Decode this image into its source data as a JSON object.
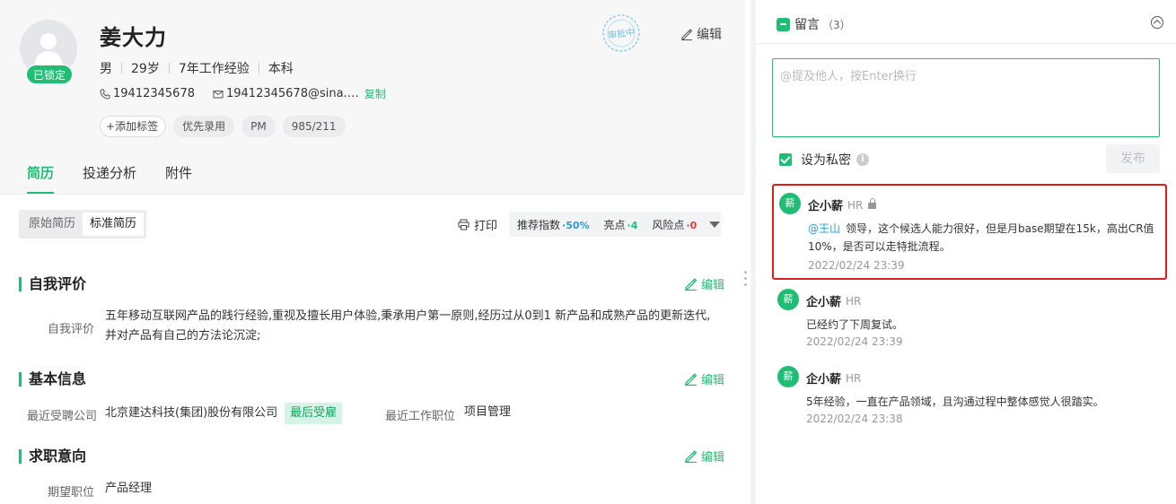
{
  "candidate": {
    "avatar_status": "已锁定",
    "name": "姜大力",
    "gender": "男",
    "age": "29岁",
    "experience": "7年工作经验",
    "education": "本科",
    "phone": "19412345678",
    "email": "19412345678@sina.…",
    "copy_label": "复制",
    "add_tag_label": "添加标签",
    "tags": [
      "优先录用",
      "PM",
      "985/211"
    ],
    "stamp_text": "审批中",
    "edit_label": "编辑"
  },
  "tabs": [
    {
      "label": "简历",
      "active": true
    },
    {
      "label": "投递分析",
      "active": false
    },
    {
      "label": "附件",
      "active": false
    }
  ],
  "resume_toolbar": {
    "views": [
      {
        "label": "原始简历",
        "active": false
      },
      {
        "label": "标准简历",
        "active": true
      }
    ],
    "print_label": "打印",
    "recommend_label": "推荐指数",
    "recommend_value": "·50%",
    "highlight_label": "亮点",
    "highlight_value": "·4",
    "risk_label": "风险点",
    "risk_value": "·0"
  },
  "sections": {
    "self_eval": {
      "title": "自我评价",
      "edit_label": "编辑",
      "field_label": "自我评价",
      "text": "五年移动互联网产品的践行经验,重视及擅长用户体验,秉承用户第一原则,经历过从0到1  新产品和成熟产品的更新迭代,并对产品有自己的方法论沉淀;"
    },
    "basic": {
      "title": "基本信息",
      "edit_label": "编辑",
      "company_label": "最近受聘公司",
      "company": "北京建达科技(集团)股份有限公司",
      "company_badge": "最后受雇",
      "position_label": "最近工作职位",
      "position": "项目管理"
    },
    "intent": {
      "title": "求职意向",
      "edit_label": "编辑",
      "position_label": "期望职位",
      "position": "产品经理"
    }
  },
  "comments_panel": {
    "title": "留言",
    "count": "（3）",
    "input_placeholder": "@提及他人，按Enter换行",
    "private_label": "设为私密",
    "private_checked": true,
    "info_icon": "i",
    "publish_label": "发布",
    "comments": [
      {
        "avatar": "薪",
        "author": "企小薪",
        "role": "HR",
        "private": true,
        "mention": "@王山",
        "text": "领导，这个候选人能力很好，但是月base期望在15k，高出CR值10%，是否可以走特批流程。",
        "time": "2022/02/24 23:39"
      },
      {
        "avatar": "薪",
        "author": "企小薪",
        "role": "HR",
        "private": false,
        "mention": "",
        "text": "已经约了下周复试。",
        "time": "2022/02/24 23:39"
      },
      {
        "avatar": "薪",
        "author": "企小薪",
        "role": "HR",
        "private": false,
        "mention": "",
        "text": "5年经验，一直在产品领域，且沟通过程中整体感觉人很踏实。",
        "time": "2022/02/24 23:38"
      }
    ]
  },
  "colors": {
    "brand_green": "#1fbe74",
    "highlight_border": "#e01b1b",
    "mention_blue": "#2b9bdb"
  }
}
